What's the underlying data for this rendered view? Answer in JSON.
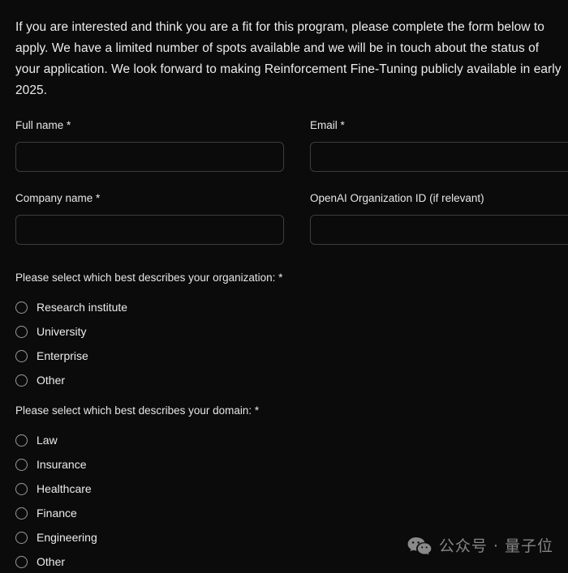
{
  "intro": {
    "paragraph": "If you are interested and think you are a fit for this program, please complete the form below to apply. We have a limited number of spots available and we will be in touch about the status of your application. We look forward to making Reinforcement Fine-Tuning publicly available in early 2025."
  },
  "form": {
    "fields": [
      {
        "label": "Full name *",
        "value": "",
        "placeholder": ""
      },
      {
        "label": "Email *",
        "value": "",
        "placeholder": ""
      },
      {
        "label": "Company name *",
        "value": "",
        "placeholder": ""
      },
      {
        "label": "OpenAI Organization ID (if relevant)",
        "value": "",
        "placeholder": ""
      }
    ],
    "questions": [
      {
        "title": "Please select which best describes your organization: *",
        "options": [
          {
            "label": "Research institute",
            "selected": false
          },
          {
            "label": "University",
            "selected": false
          },
          {
            "label": "Enterprise",
            "selected": false
          },
          {
            "label": "Other",
            "selected": false
          }
        ]
      },
      {
        "title": "Please select which best describes your domain: *",
        "options": [
          {
            "label": "Law",
            "selected": false
          },
          {
            "label": "Insurance",
            "selected": false
          },
          {
            "label": "Healthcare",
            "selected": false
          },
          {
            "label": "Finance",
            "selected": false
          },
          {
            "label": "Engineering",
            "selected": false
          },
          {
            "label": "Other",
            "selected": false
          }
        ]
      }
    ]
  },
  "watermark": {
    "icon": "wechat-icon",
    "text": "公众号 · 量子位"
  },
  "colors": {
    "background": "#0b0b0b",
    "text": "#ececec",
    "input_border": "#3d3d3d",
    "radio_border": "#9a9a9a",
    "watermark_text": "#cfcfcf"
  }
}
